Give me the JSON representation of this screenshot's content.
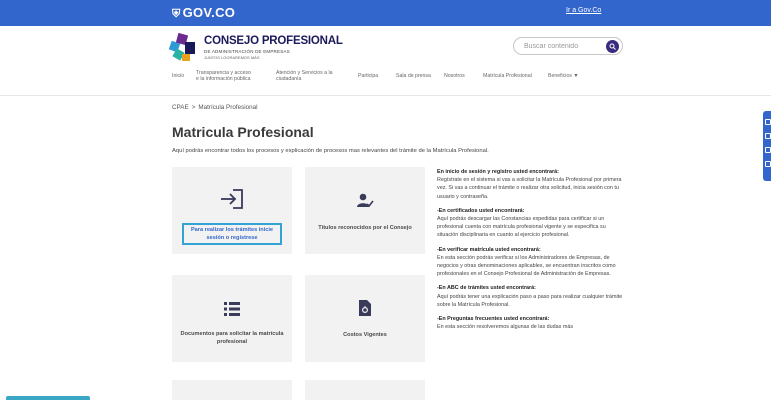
{
  "gov_bar": {
    "logo": "GOV.CO",
    "link": "Ir a Gov.Co"
  },
  "header": {
    "brand_title": "CONSEJO PROFESIONAL",
    "brand_sub1": "DE ADMINISTRACIÓN DE EMPRESAS",
    "brand_sub2": "JUNTOS LOGRAREMOS MÁS",
    "search_placeholder": "Buscar contenido"
  },
  "nav": [
    {
      "label": "Inicio"
    },
    {
      "label": "Transparencia y acceso\ne la información pública"
    },
    {
      "label": "Atención y Servicios a la\nciudadanía"
    },
    {
      "label": "Participa"
    },
    {
      "label": "Sala de prensa"
    },
    {
      "label": "Nosotros"
    },
    {
      "label": "Matrícula Profesional"
    },
    {
      "label": "Beneficios ▼"
    }
  ],
  "breadcrumb": {
    "root": "CPAE",
    "sep": ">",
    "current": "Matrícula Profesional"
  },
  "page": {
    "title": "Matricula Profesional",
    "description": "Aquí podrás encontrar todos los procesos y explicación de procesos mas relevantes del trámite de la Matrícula Profesional."
  },
  "cards": [
    {
      "label": "Para realizar los trámites inicie sesión o regístrese",
      "icon": "login-icon"
    },
    {
      "label": "Títulos reconocidos por el Consejo",
      "icon": "user-check-icon"
    },
    {
      "label": "Documentos para solicitar la matrícula profesional",
      "icon": "list-icon"
    },
    {
      "label": "Costos Vigentes",
      "icon": "document-icon"
    }
  ],
  "info": [
    {
      "heading": "En inicio de sesión y registro usted encontrará:",
      "body": "Regístrate en el sistema si vas a solicitar la Matrícula Profesional por primera vez. Si vas a continuar el trámite o realizar otra solicitud, inicia sesión con tu usuario y contraseña."
    },
    {
      "heading": "-En certificados usted encontrará:",
      "body": "Aquí podrás descargar  las Constancias expedidas para certificar si un profesional cuenta con matrícula profesional vigente y se especifica su situación disciplinaria en cuanto al ejercicio profesional."
    },
    {
      "heading": "-En verificar matrícula usted encontrará:",
      "body": "En esta sección podrás verificar si los Administradores de Empresas, de negocios y otras denominaciones aplicables, se encuentran inscritos como profesionales en el Consejo Profesional de Administración de Empresas."
    },
    {
      "heading": "-En ABC de trámites usted encontrará:",
      "body": "Aquí podrás tener una explicación paso a paso para realizar cualquier trámite sobre la Matrícula Profesional."
    },
    {
      "heading": "-En Preguntas frecuentes usted encontrará:",
      "body": "En esta sección resolveremos algunas de las dudas más"
    }
  ],
  "colors": {
    "gov_blue": "#3366cc",
    "brand_navy": "#1a1a5a",
    "focus_ring": "#33a3d6",
    "card_bg": "#f2f2f2"
  }
}
